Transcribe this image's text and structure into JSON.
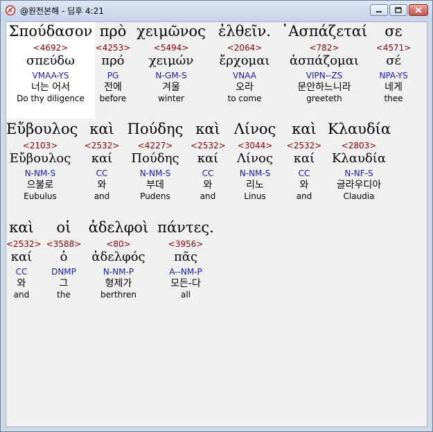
{
  "window": {
    "title": "@원전본해 - 딤후 4:21"
  },
  "rows": [
    [
      {
        "greek": "Σπούδασον",
        "strong": "<4692>",
        "lemma": "σπεύδω",
        "parse": "VMAA-YS",
        "kor": "너는 어서",
        "eng": "Do thy diligence"
      },
      {
        "greek": "πρὸ",
        "strong": "<4253>",
        "lemma": "πρό",
        "parse": "PG",
        "kor": "전에",
        "eng": "before"
      },
      {
        "greek": "χειμῶνος",
        "strong": "<5494>",
        "lemma": "χειμών",
        "parse": "N-GM-S",
        "kor": "겨울",
        "eng": "winter"
      },
      {
        "greek": "ἐλθεῖν.",
        "strong": "<2064>",
        "lemma": "ἔρχομαι",
        "parse": "VNAA",
        "kor": "오라",
        "eng": "to come"
      },
      {
        "greek": "᾿Ασπάζεταί",
        "strong": "<782>",
        "lemma": "ἀσπάζομαι",
        "parse": "VIPN--ZS",
        "kor": "문안하느니라",
        "eng": "greeteth"
      },
      {
        "greek": "σε",
        "strong": "<4571>",
        "lemma": "σέ",
        "parse": "NPA-YS",
        "kor": "네게",
        "eng": "thee"
      }
    ],
    [
      {
        "greek": "Εὔβουλος",
        "strong": "<2103>",
        "lemma": "Εὔβουλος",
        "parse": "N-NM-S",
        "kor": "으불로",
        "eng": "Eubulus"
      },
      {
        "greek": "καὶ",
        "strong": "<2532>",
        "lemma": "καί",
        "parse": "CC",
        "kor": "와",
        "eng": "and"
      },
      {
        "greek": "Πούδης",
        "strong": "<4227>",
        "lemma": "Πούδης",
        "parse": "N-NM-S",
        "kor": "부데",
        "eng": "Pudens"
      },
      {
        "greek": "καὶ",
        "strong": "<2532>",
        "lemma": "καί",
        "parse": "CC",
        "kor": "와",
        "eng": "and"
      },
      {
        "greek": "Λίνος",
        "strong": "<3044>",
        "lemma": "Λίνος",
        "parse": "N-NM-S",
        "kor": "리노",
        "eng": "Linus"
      },
      {
        "greek": "καὶ",
        "strong": "<2532>",
        "lemma": "καί",
        "parse": "CC",
        "kor": "와",
        "eng": "and"
      },
      {
        "greek": "Κλαυδία",
        "strong": "<2803>",
        "lemma": "Κλαυδία",
        "parse": "N-NF-S",
        "kor": "글라우디아",
        "eng": "Claudia"
      }
    ],
    [
      {
        "greek": "καὶ",
        "strong": "<2532>",
        "lemma": "καί",
        "parse": "CC",
        "kor": "와",
        "eng": "and"
      },
      {
        "greek": "οἱ",
        "strong": "<3588>",
        "lemma": "ὁ",
        "parse": "DNMP",
        "kor": "그",
        "eng": "the"
      },
      {
        "greek": "ἀδελφοὶ",
        "strong": "<80>",
        "lemma": "ἀδελφός",
        "parse": "N-NM-P",
        "kor": "형제가",
        "eng": "berthren"
      },
      {
        "greek": "πάντες.",
        "strong": "<3956>",
        "lemma": "πᾶς",
        "parse": "A--NM-P",
        "kor": "모든-다",
        "eng": "all"
      }
    ]
  ]
}
